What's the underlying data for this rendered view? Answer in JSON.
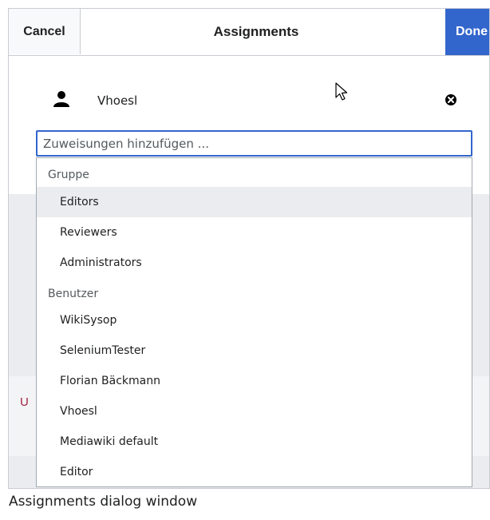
{
  "header": {
    "cancel_label": "Cancel",
    "title": "Assignments",
    "done_label": "Done"
  },
  "assignee": {
    "icon": "user-icon",
    "name": "Vhoesl",
    "remove_icon": "remove-circle-icon"
  },
  "search": {
    "placeholder": "Zuweisungen hinzufügen ..."
  },
  "dropdown": {
    "groups_label": "Gruppe",
    "groups": [
      "Editors",
      "Reviewers",
      "Administrators"
    ],
    "highlighted": "Editors",
    "users_label": "Benutzer",
    "users": [
      "WikiSysop",
      "SeleniumTester",
      "Florian Bäckmann",
      "Vhoesl",
      "Mediawiki default",
      "Editor"
    ]
  },
  "background": {
    "partial_text": "U"
  },
  "caption": "Assignments dialog window",
  "colors": {
    "primary": "#3366cc",
    "border": "#c8ccd1",
    "highlight": "#eaecf0",
    "text": "#202122"
  }
}
